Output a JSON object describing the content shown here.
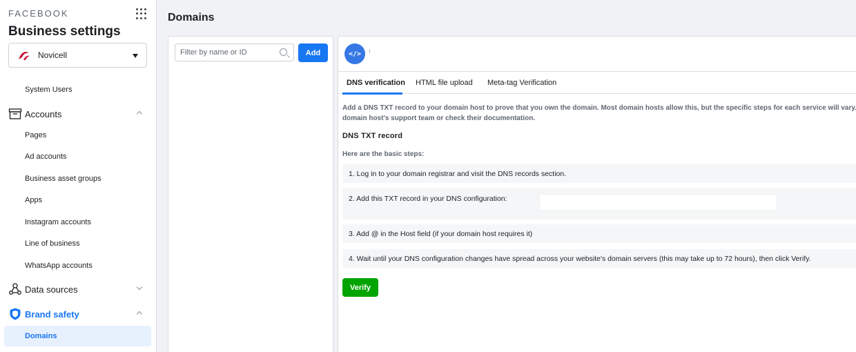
{
  "sidebar": {
    "brand": "FACEBOOK",
    "title": "Business settings",
    "account": "Novicell",
    "items": {
      "system_users": "System Users",
      "accounts": "Accounts",
      "pages": "Pages",
      "ad_accounts": "Ad accounts",
      "business_asset_groups": "Business asset groups",
      "apps": "Apps",
      "instagram_accounts": "Instagram accounts",
      "line_of_business": "Line of business",
      "whatsapp_accounts": "WhatsApp accounts",
      "data_sources": "Data sources",
      "brand_safety": "Brand safety",
      "domains": "Domains"
    }
  },
  "header": {
    "title": "Domains"
  },
  "list": {
    "filter_placeholder": "Filter by name or ID",
    "add_label": "Add"
  },
  "detail": {
    "badge": "</>",
    "tabs": [
      "DNS verification",
      "HTML file upload",
      "Meta-tag Verification"
    ],
    "intro_line1": "Add a DNS TXT record to your domain host to prove that you own the domain. Most domain hosts allow this, but the specific steps for each service will vary. If",
    "intro_line2": "domain host's support team or check their documentation.",
    "section_title": "DNS TXT record",
    "steps_heading": "Here are the basic steps:",
    "steps": [
      "1. Log in to your domain registrar and visit the DNS records section.",
      "2. Add this TXT record in your DNS configuration:",
      "3. Add @ in the Host field (if your domain host requires it)",
      "4. Wait until your DNS configuration changes have spread across your website's domain servers (this may take up to 72 hours), then click Verify."
    ],
    "verify_label": "Verify"
  },
  "colors": {
    "accent": "#1877f2",
    "verify": "#00a400",
    "active_bg": "#e7f0fd"
  }
}
